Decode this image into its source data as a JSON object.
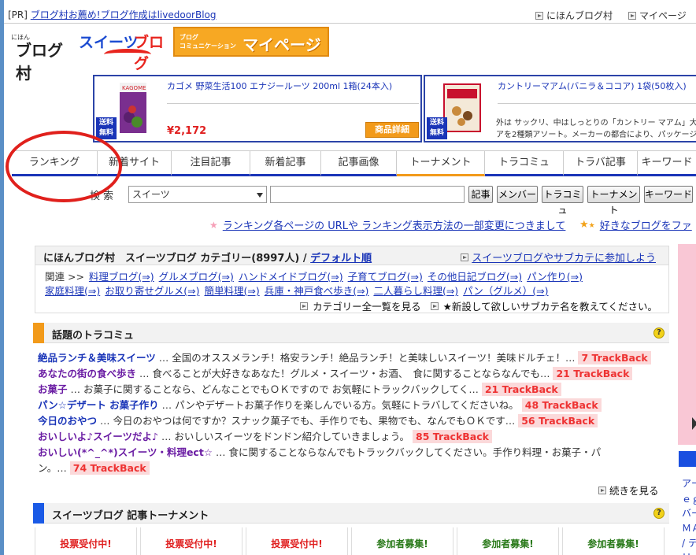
{
  "topbar": {
    "pr_prefix": "[PR]",
    "pr_link": "ブログ村お薦め!ブログ作成はlivedoorBlog",
    "links": [
      "にほんブログ村",
      "マイページ"
    ]
  },
  "logos": {
    "nihon_small": "にほん",
    "nihon_big": "ブログ村",
    "sweets_blue": "スイーツ",
    "sweets_red": "ブログ",
    "mypage_small_1": "ブログ",
    "mypage_small_2": "コミュニケーション",
    "mypage_big": "マイページ"
  },
  "ads": [
    {
      "brand": "KAGOME",
      "flag": "送料 無料",
      "title": "カゴメ 野菜生活100 エナジールーツ 200ml 1箱(24本入)",
      "price": "¥2,172",
      "button": "商品詳細"
    },
    {
      "flag": "送料 無料",
      "title": "カントリーマアム(バニラ＆ココア) 1袋(50枚入)",
      "desc1": "外は サックリ、中はしっとりの「カントリー マアム」大袋。",
      "desc2": "アを2種類アソート。メーカーの都合により、パッケージ"
    }
  ],
  "tabs": [
    "ランキング",
    "新着サイト",
    "注目記事",
    "新着記事",
    "記事画像",
    "トーナメント",
    "トラコミュ",
    "トラバ記事",
    "キーワード"
  ],
  "search": {
    "label": "検索",
    "selected": "スイーツ",
    "buttons": [
      "記事",
      "メンバー",
      "トラコミュ",
      "トーナメント",
      "キーワード"
    ]
  },
  "notices": {
    "notice1": "ランキング各ページの URLや ランキング表示方法の一部変更につきまして",
    "notice2": "好きなブログをファ"
  },
  "category": {
    "title_prefix": "にほんブログ村　スイーツブログ カテゴリー(8997人) / ",
    "title_link": "デフォルト順",
    "join": "スイーツブログやサブカテに参加しよう",
    "related_label": "関連 >>",
    "row1": [
      "料理ブログ(⇒)",
      "グルメブログ(⇒)",
      "ハンドメイドブログ(⇒)",
      "子育てブログ(⇒)",
      "その他日記ブログ(⇒)",
      "パン作り(⇒)"
    ],
    "row2": [
      "家庭料理(⇒)",
      "お取り寄せグルメ(⇒)",
      "簡単料理(⇒)",
      "兵庫・神戸食べ歩き(⇒)",
      "二人暮らし料理(⇒)",
      "パン（グルメ）(⇒)"
    ],
    "link_all": "カテゴリー全一覧を見る",
    "link_new": "★新設して欲しいサブカテ名を教えてください。"
  },
  "trackcommu": {
    "title": "話題のトラコミュ",
    "help": "?",
    "items": [
      {
        "name": "絶品ランチ＆美味スイーツ",
        "desc": " … 全国のオススメランチ！格安ランチ！絶品ランチ！と美味しいスイーツ！美味ドルチェ！…",
        "tb": "7 TrackBack"
      },
      {
        "name": "あなたの街の食べ歩き",
        "desc": " … 食べることが大好きなあなた！グルメ・スイーツ・お酒、　食に関することならなんでも…",
        "tb": "21 TrackBack"
      },
      {
        "name": "お菓子",
        "desc": " … お菓子に関することなら、どんなことでもＯＫですので お気軽にトラックバックしてく…",
        "tb": "21 TrackBack"
      },
      {
        "name": "パン☆デザート お菓子作り",
        "desc": " … パンやデザートお菓子作りを楽しんでいる方。気軽にトラバしてくださいね。",
        "tb": "48 TrackBack"
      },
      {
        "name": "今日のおやつ",
        "desc": " … 今日のおやつは何ですか？スナック菓子でも、手作りでも、果物でも、なんでもＯＫです…",
        "tb": "56 TrackBack"
      },
      {
        "name": "おいしいよ♪スイーツだよ♪",
        "desc": " … おいしいスイーツをドンドン紹介していきましょう。",
        "tb": "85 TrackBack"
      },
      {
        "name": "おいしい(*^_^*)スイーツ・料理ect☆",
        "desc": " … 食に関することならなんでもトラックバックしてください。手作り料理・お菓子・パ",
        "tb": ""
      }
    ],
    "last_line": "ン。…",
    "last_tb": "74 TrackBack",
    "more": "続きを見る"
  },
  "tournament": {
    "title": "スイーツブログ 記事トーナメント",
    "help": "?",
    "cells": [
      "投票受付中!",
      "投票受付中!",
      "投票受付中!",
      "参加者募集!",
      "参加者募集!",
      "参加者募集!"
    ]
  },
  "right_side": [
    "アー",
    "ｅｇ",
    "バー",
    "ＭＡ",
    "/ テ",
    "Ｈｏ"
  ],
  "colors": {
    "link": "#1a35b8",
    "tab_underline": "#1a35b8",
    "accent_orange": "#f29a1a",
    "trackback_bg": "#fbd9da",
    "trackback_text": "#ee3333",
    "annotation_red": "#e0201c"
  }
}
